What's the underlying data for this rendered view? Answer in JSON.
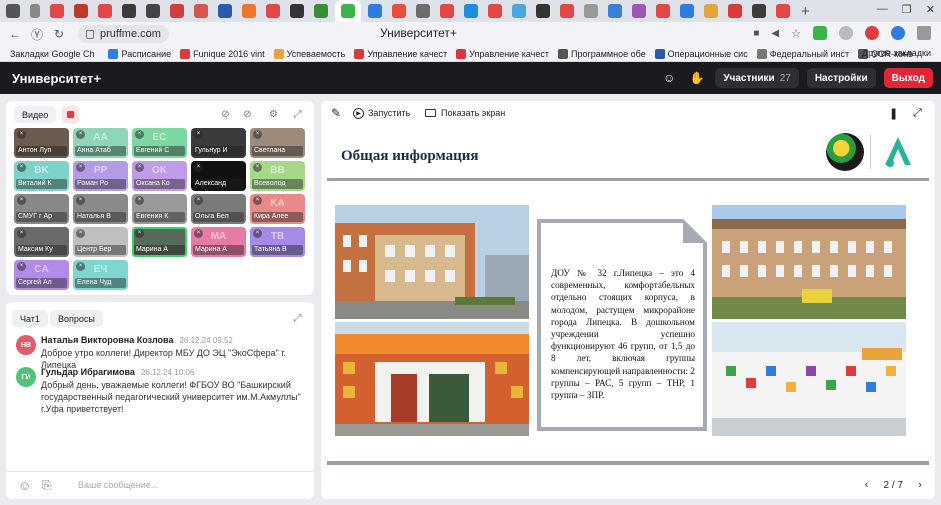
{
  "browser": {
    "address": "pruffme.com",
    "page_title": "Университет+",
    "tab_colors": [
      "#e34848",
      "#c0392b",
      "#e34848",
      "#3c3c3c",
      "#444",
      "#d43b3b",
      "#d9534f",
      "#2b5aa8",
      "#f0772a",
      "#e34848",
      "#333",
      "#3a8e3a",
      "#2f7de0",
      "#e84e3c",
      "#6c6c6c",
      "#e34848",
      "#1e8de0",
      "#e34848",
      "#4aa7e0",
      "#333",
      "#e34848",
      "#999",
      "#3d7fd6",
      "#9b59b6",
      "#e34848",
      "#2f7de0",
      "#e4a53d",
      "#d8393a",
      "#3d3d3d",
      "#e34848"
    ],
    "bookmarks": [
      {
        "label": "Закладки Google Ch",
        "color": "#f0a030"
      },
      {
        "label": "Расписание",
        "color": "#2f7de0"
      },
      {
        "label": "Funique 2016 vint",
        "color": "#d8393a"
      },
      {
        "label": "Успеваемость",
        "color": "#e4a53d"
      },
      {
        "label": "Управление качест",
        "color": "#d8393a"
      },
      {
        "label": "Управление качест",
        "color": "#d8393a"
      },
      {
        "label": "Программное обе",
        "color": "#555"
      },
      {
        "label": "Операционные сис",
        "color": "#2b5aa8"
      },
      {
        "label": "Федеральный инст",
        "color": "#777"
      },
      {
        "label": "OCR-конв",
        "color": "#555"
      }
    ],
    "bookmarks_lead": "Закладки Google Ch",
    "other_bookmarks": "Другие закладки"
  },
  "header": {
    "title": "Университет+",
    "participants_label": "Участники",
    "participants_count": "27",
    "settings_label": "Настройки",
    "exit_label": "Выход"
  },
  "video": {
    "label": "Видео",
    "tiles": [
      {
        "name": "Антон Луп",
        "init": "",
        "color": "#6b5a4e"
      },
      {
        "name": "Анна Атаб",
        "init": "AA",
        "color": "#8fd6b8"
      },
      {
        "name": "Евгений С",
        "init": "EC",
        "color": "#7ed6a3"
      },
      {
        "name": "Гульнур И",
        "init": "",
        "color": "#3a3a3a"
      },
      {
        "name": "Светлана",
        "init": "",
        "color": "#9d8a7a"
      },
      {
        "name": "Виталий К",
        "init": "BK",
        "color": "#7dd3c9"
      },
      {
        "name": "Роман Ро",
        "init": "PP",
        "color": "#b39be8"
      },
      {
        "name": "Оксана Ко",
        "init": "OK",
        "color": "#c09be6"
      },
      {
        "name": "Александ",
        "init": "",
        "color": "#111"
      },
      {
        "name": "Всеволод",
        "init": "BB",
        "color": "#a6d88a"
      },
      {
        "name": "СМУГ г Ар",
        "init": "",
        "color": "#888"
      },
      {
        "name": "Наталья В",
        "init": "",
        "color": "#8a8a8a"
      },
      {
        "name": "Евгения К",
        "init": "",
        "color": "#9a9a9a"
      },
      {
        "name": "Ольга Бел",
        "init": "",
        "color": "#7a7a7a"
      },
      {
        "name": "Кира Алее",
        "init": "KA",
        "color": "#e88a8a"
      },
      {
        "name": "Максим Ку",
        "init": "",
        "color": "#6a6a6a"
      },
      {
        "name": "Центр Бер",
        "init": "",
        "color": "#bfbfbf"
      },
      {
        "name": "Марина А",
        "init": "",
        "color": "#5a6a5a"
      },
      {
        "name": "Марина А",
        "init": "MA",
        "color": "#e87aa8"
      },
      {
        "name": "Татьяна В",
        "init": "TB",
        "color": "#a68ae8"
      },
      {
        "name": "Сергей Ал",
        "init": "CA",
        "color": "#b48ae8"
      },
      {
        "name": "Елена Чуд",
        "init": "EЧ",
        "color": "#7ed6d0"
      }
    ]
  },
  "chat": {
    "tab_chat": "Чат1",
    "tab_questions": "Вопросы",
    "messages": [
      {
        "initials": "НВ",
        "color": "#e05c6a",
        "author": "Наталья Викторовна Козлова",
        "time": "26.12.24 09:52",
        "text": "Доброе утро коллеги! Директор МБУ ДО ЭЦ \"ЭкоСфера\" г. Липецка"
      },
      {
        "initials": "ГИ",
        "color": "#55c27a",
        "author": "Гульдар Ибрагимова",
        "time": "26.12.24 10:06",
        "text": "Добрый день, уважаемые коллеги! ФГБОУ ВО \"Башкирский государственный педагогический университет им.М.Акмуллы\" г.Уфа приветствует!"
      }
    ],
    "input_placeholder": "Ваше сообщение..."
  },
  "presentation": {
    "run_label": "Запустить",
    "share_label": "Показать экран",
    "slide_title": "Общая информация",
    "slide_text": "ДОУ № 32 г.Липецка – это 4 современных, комфортабельных отдельно стоящих корпуса, в молодом, растущем микрорайоне города Липецка. В дошкольном учреждении успешно функционируют 46 групп, от 1,5 до 8 лет, включая группы компенсирующей направленности: 2 группы – РАС, 5 групп – ТНР, 1 группа – ЗПР.",
    "current_page": "2",
    "total_pages": "7",
    "page_sep": "/"
  }
}
